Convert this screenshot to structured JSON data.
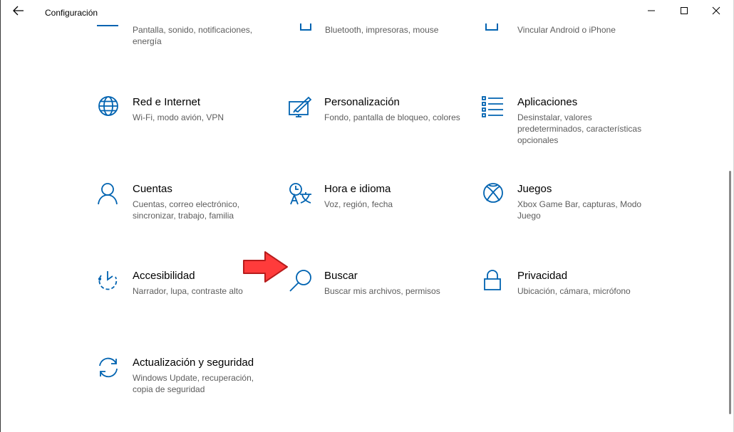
{
  "window": {
    "title": "Configuración",
    "controls": {
      "minimize_icon": "minimize-icon",
      "maximize_icon": "maximize-icon",
      "close_icon": "close-icon"
    }
  },
  "accent_color": "#0063b1",
  "annotation_color": "#ff3b3b",
  "top_row_partial": [
    {
      "icon": "system-display-icon",
      "description": "Pantalla, sonido, notificaciones, energía"
    },
    {
      "icon": "devices-icon",
      "description": "Bluetooth, impresoras, mouse"
    },
    {
      "icon": "phone-icon",
      "description": "Vincular Android o iPhone"
    }
  ],
  "categories": [
    {
      "icon": "globe-icon",
      "title": "Red e Internet",
      "description": "Wi-Fi, modo avión, VPN"
    },
    {
      "icon": "personalization-icon",
      "title": "Personalización",
      "description": "Fondo, pantalla de bloqueo, colores"
    },
    {
      "icon": "apps-list-icon",
      "title": "Aplicaciones",
      "description": "Desinstalar, valores predeterminados, características opcionales"
    },
    {
      "icon": "person-icon",
      "title": "Cuentas",
      "description": "Cuentas, correo electrónico, sincronizar, trabajo, familia"
    },
    {
      "icon": "time-language-icon",
      "title": "Hora e idioma",
      "description": "Voz, región, fecha"
    },
    {
      "icon": "xbox-icon",
      "title": "Juegos",
      "description": "Xbox Game Bar, capturas, Modo Juego"
    },
    {
      "icon": "accessibility-icon",
      "title": "Accesibilidad",
      "description": "Narrador, lupa, contraste alto"
    },
    {
      "icon": "search-icon",
      "title": "Buscar",
      "description": "Buscar mis archivos, permisos"
    },
    {
      "icon": "lock-icon",
      "title": "Privacidad",
      "description": "Ubicación, cámara, micrófono"
    },
    {
      "icon": "sync-icon",
      "title": "Actualización y seguridad",
      "description": "Windows Update, recuperación, copia de seguridad"
    }
  ]
}
